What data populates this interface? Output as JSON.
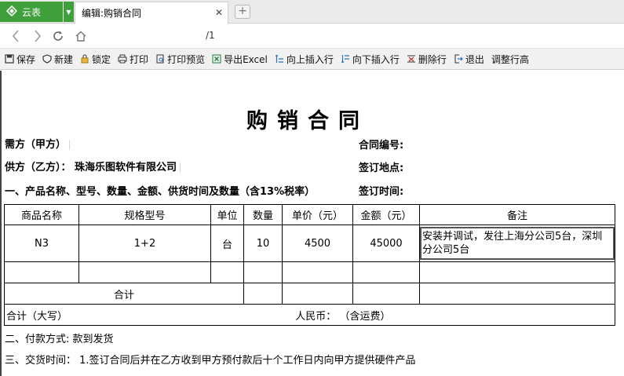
{
  "browser": {
    "app_name": "云表",
    "tab_title": "编辑:购销合同",
    "url": "/1"
  },
  "toolbar": {
    "items": [
      {
        "label": "保存",
        "icon": "save-icon"
      },
      {
        "label": "新建",
        "icon": "shield-icon"
      },
      {
        "label": "锁定",
        "icon": "lock-icon"
      },
      {
        "label": "打印",
        "icon": "printer-icon"
      },
      {
        "label": "打印预览",
        "icon": "print-preview-icon"
      },
      {
        "label": "导出Excel",
        "icon": "excel-icon"
      },
      {
        "label": "向上插入行",
        "icon": "insert-row-above-icon"
      },
      {
        "label": "向下插入行",
        "icon": "insert-row-below-icon"
      },
      {
        "label": "删除行",
        "icon": "delete-row-icon"
      },
      {
        "label": "退出",
        "icon": "exit-icon"
      },
      {
        "label": "调整行高",
        "icon": ""
      }
    ]
  },
  "document": {
    "title": "购销合同",
    "buyer_label": "需方（甲方）",
    "seller_label": "供方（乙方）：",
    "seller_value": "珠海乐图软件有限公司",
    "contract_no_label": "合同编号:",
    "sign_place_label": "签订地点:",
    "sign_time_label": "签订时间:",
    "section1": "一、产品名称、型号、数量、金额、供货时间及数量（含13%税率）",
    "table": {
      "headers": [
        "商品名称",
        "规格型号",
        "单位",
        "数量",
        "单价（元）",
        "金额（元）",
        "备注"
      ],
      "rows": [
        [
          "N3",
          "1+2",
          "台",
          "10",
          "4500",
          "45000",
          "安装并调试，发往上海分公司5台，深圳分公司5台"
        ]
      ],
      "subtotal_label": "合计",
      "total_caps_label": "合计（大写）",
      "rmb_label": "人民币：",
      "freight_note": "（含运费）"
    },
    "section2": "二、付款方式: 款到发货",
    "section3": "三、交货时间：  1.签订合同后并在乙方收到甲方预付款后十个工作日内向甲方提供硬件产品"
  },
  "colors": {
    "app_green": "#3f9f3a",
    "toolbar_bg": "#f1f1f1"
  }
}
